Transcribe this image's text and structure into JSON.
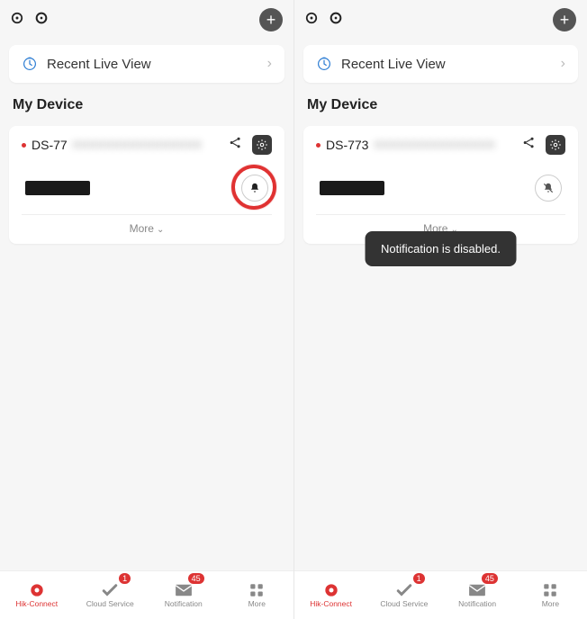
{
  "left": {
    "recent_label": "Recent Live View",
    "section_title": "My Device",
    "device_name": "DS-77",
    "device_blur": "XXXXXXXXXXXXXXXX",
    "more_label": "More",
    "bell_state": "enabled",
    "nav": {
      "hik": "Hik-Connect",
      "cloud": "Cloud Service",
      "cloud_badge": "1",
      "notif": "Notification",
      "notif_badge": "45",
      "more": "More"
    }
  },
  "right": {
    "recent_label": "Recent Live View",
    "section_title": "My Device",
    "device_name": "DS-773",
    "device_blur": "XXXXXXXXXXXXXXX",
    "more_label": "More",
    "bell_state": "disabled",
    "toast": "Notification is disabled.",
    "nav": {
      "hik": "Hik-Connect",
      "cloud": "Cloud Service",
      "cloud_badge": "1",
      "notif": "Notification",
      "notif_badge": "45",
      "more": "More"
    }
  }
}
